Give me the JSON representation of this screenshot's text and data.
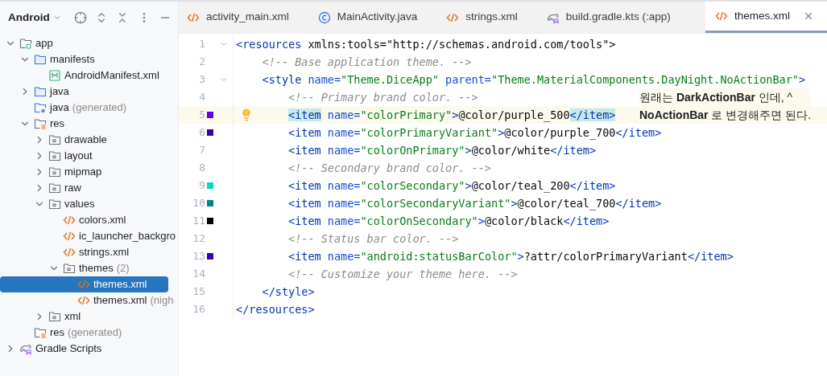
{
  "project_panel": {
    "title": "Android",
    "tree": [
      {
        "label": "app",
        "kind": "module",
        "expanded": true,
        "selected": false,
        "children": [
          {
            "label": "manifests",
            "kind": "folder",
            "expanded": true,
            "selected": false,
            "children": [
              {
                "label": "AndroidManifest.xml",
                "kind": "manifest",
                "selected": false
              }
            ]
          },
          {
            "label": "java",
            "kind": "folder",
            "expanded": false,
            "selected": false
          },
          {
            "label": "java",
            "note": "(generated)",
            "kind": "generated",
            "selected": false
          },
          {
            "label": "res",
            "kind": "res",
            "expanded": true,
            "selected": false,
            "children": [
              {
                "label": "drawable",
                "kind": "resfolder",
                "expanded": false,
                "selected": false
              },
              {
                "label": "layout",
                "kind": "resfolder",
                "expanded": false,
                "selected": false
              },
              {
                "label": "mipmap",
                "kind": "resfolder",
                "expanded": false,
                "selected": false
              },
              {
                "label": "raw",
                "kind": "resfolder",
                "expanded": false,
                "selected": false
              },
              {
                "label": "values",
                "kind": "resfolder",
                "expanded": true,
                "selected": false,
                "children": [
                  {
                    "label": "colors.xml",
                    "kind": "xml",
                    "selected": false
                  },
                  {
                    "label": "ic_launcher_backgro",
                    "kind": "xml",
                    "selected": false
                  },
                  {
                    "label": "strings.xml",
                    "kind": "xml",
                    "selected": false
                  },
                  {
                    "label": "themes",
                    "note": "(2)",
                    "kind": "resfolder",
                    "expanded": true,
                    "selected": false,
                    "children": [
                      {
                        "label": "themes.xml",
                        "kind": "xml",
                        "selected": true
                      },
                      {
                        "label": "themes.xml",
                        "note": "(nigh",
                        "kind": "xml",
                        "selected": false
                      }
                    ]
                  }
                ]
              },
              {
                "label": "xml",
                "kind": "resfolder",
                "expanded": false,
                "selected": false
              }
            ]
          },
          {
            "label": "res",
            "note": "(generated)",
            "kind": "res",
            "selected": false
          }
        ]
      },
      {
        "label": "Gradle Scripts",
        "kind": "gradle",
        "expanded": false,
        "selected": false
      }
    ]
  },
  "tabs": [
    {
      "label": "activity_main.xml",
      "kind": "xml",
      "selected": false
    },
    {
      "label": "MainActivity.java",
      "kind": "class",
      "selected": false
    },
    {
      "label": "strings.xml",
      "kind": "xml",
      "selected": false
    },
    {
      "label": "build.gradle.kts (:app)",
      "kind": "gradle",
      "selected": false
    },
    {
      "label": "themes.xml",
      "kind": "xml",
      "selected": true
    }
  ],
  "editor": {
    "lines": [
      {
        "number": "1",
        "fold": true,
        "current": false,
        "tokens": [
          {
            "kind": "tag",
            "text": "<resources "
          },
          {
            "kind": "plain",
            "text": "xmlns:tools=\"http://schemas.android.com/tools\">"
          }
        ]
      },
      {
        "number": "2",
        "fold": false,
        "current": false,
        "tokens": [
          {
            "kind": "comment",
            "text": "    <!-- Base application theme. -->"
          }
        ]
      },
      {
        "number": "3",
        "fold": true,
        "current": false,
        "tokens": [
          {
            "kind": "tag",
            "text": "    <style "
          },
          {
            "kind": "attr",
            "text": "name="
          },
          {
            "kind": "value",
            "text": "\"Theme.DiceApp\" "
          },
          {
            "kind": "attr",
            "text": "parent="
          },
          {
            "kind": "value",
            "text": "\"Theme.MaterialComponents.DayNight.NoActionBar\""
          },
          {
            "kind": "tag",
            "text": ">"
          }
        ]
      },
      {
        "number": "4",
        "fold": false,
        "current": false,
        "tokens": [
          {
            "kind": "comment",
            "text": "        <!-- Primary brand color. -->"
          }
        ]
      },
      {
        "number": "5",
        "fold": false,
        "current": true,
        "color": "#6200ee",
        "bulb": true,
        "tokens": [
          {
            "kind": "match",
            "text": "        <item"
          },
          {
            "kind": "attr",
            "text": " name="
          },
          {
            "kind": "value",
            "text": "\"colorPrimary\""
          },
          {
            "kind": "tag",
            "text": ">"
          },
          {
            "kind": "plain",
            "text": "@color/purple_500"
          },
          {
            "kind": "match",
            "text": "</item>"
          }
        ]
      },
      {
        "number": "6",
        "fold": false,
        "current": false,
        "color": "#3700b3",
        "tokens": [
          {
            "kind": "tag",
            "text": "        <item"
          },
          {
            "kind": "attr",
            "text": " name="
          },
          {
            "kind": "value",
            "text": "\"colorPrimaryVariant\""
          },
          {
            "kind": "tag",
            "text": ">"
          },
          {
            "kind": "plain",
            "text": "@color/purple_700"
          },
          {
            "kind": "tag",
            "text": "</item>"
          }
        ]
      },
      {
        "number": "7",
        "fold": false,
        "current": false,
        "tokens": [
          {
            "kind": "tag",
            "text": "        <item"
          },
          {
            "kind": "attr",
            "text": " name="
          },
          {
            "kind": "value",
            "text": "\"colorOnPrimary\""
          },
          {
            "kind": "tag",
            "text": ">"
          },
          {
            "kind": "plain",
            "text": "@color/white"
          },
          {
            "kind": "tag",
            "text": "</item>"
          }
        ]
      },
      {
        "number": "8",
        "fold": false,
        "current": false,
        "tokens": [
          {
            "kind": "comment",
            "text": "        <!-- Secondary brand color. -->"
          }
        ]
      },
      {
        "number": "9",
        "fold": false,
        "current": false,
        "color": "#03dac5",
        "tokens": [
          {
            "kind": "tag",
            "text": "        <item"
          },
          {
            "kind": "attr",
            "text": " name="
          },
          {
            "kind": "value",
            "text": "\"colorSecondary\""
          },
          {
            "kind": "tag",
            "text": ">"
          },
          {
            "kind": "plain",
            "text": "@color/teal_200"
          },
          {
            "kind": "tag",
            "text": "</item>"
          }
        ]
      },
      {
        "number": "10",
        "fold": false,
        "current": false,
        "color": "#018786",
        "tokens": [
          {
            "kind": "tag",
            "text": "        <item"
          },
          {
            "kind": "attr",
            "text": " name="
          },
          {
            "kind": "value",
            "text": "\"colorSecondaryVariant\""
          },
          {
            "kind": "tag",
            "text": ">"
          },
          {
            "kind": "plain",
            "text": "@color/teal_700"
          },
          {
            "kind": "tag",
            "text": "</item>"
          }
        ]
      },
      {
        "number": "11",
        "fold": false,
        "current": false,
        "color": "#000000",
        "tokens": [
          {
            "kind": "tag",
            "text": "        <item"
          },
          {
            "kind": "attr",
            "text": " name="
          },
          {
            "kind": "value",
            "text": "\"colorOnSecondary\""
          },
          {
            "kind": "tag",
            "text": ">"
          },
          {
            "kind": "plain",
            "text": "@color/black"
          },
          {
            "kind": "tag",
            "text": "</item>"
          }
        ]
      },
      {
        "number": "12",
        "fold": false,
        "current": false,
        "tokens": [
          {
            "kind": "comment",
            "text": "        <!-- Status bar color. -->"
          }
        ]
      },
      {
        "number": "13",
        "fold": false,
        "current": false,
        "color": "#3700b3",
        "tokens": [
          {
            "kind": "tag",
            "text": "        <item"
          },
          {
            "kind": "attr",
            "text": " name="
          },
          {
            "kind": "value",
            "text": "\"android:statusBarColor\""
          },
          {
            "kind": "tag",
            "text": ">"
          },
          {
            "kind": "plain",
            "text": "?attr/colorPrimaryVariant"
          },
          {
            "kind": "tag",
            "text": "</item>"
          }
        ]
      },
      {
        "number": "14",
        "fold": false,
        "current": false,
        "tokens": [
          {
            "kind": "comment",
            "text": "        <!-- Customize your theme here. -->"
          }
        ]
      },
      {
        "number": "15",
        "fold": false,
        "current": false,
        "tokens": [
          {
            "kind": "tag",
            "text": "    </style>"
          }
        ]
      },
      {
        "number": "16",
        "fold": false,
        "current": false,
        "tokens": [
          {
            "kind": "tag",
            "text": "</resources>"
          }
        ]
      }
    ],
    "annotation": [
      "원래는 **DarkActionBar** 인데,  ^",
      "**NoActionBar** 로 변경해주면 된다."
    ]
  }
}
